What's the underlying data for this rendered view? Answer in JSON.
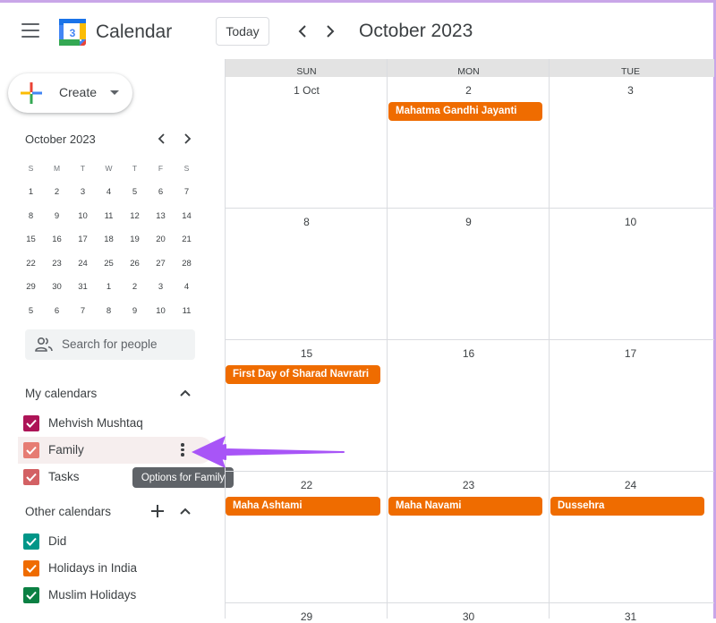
{
  "header": {
    "app_title": "Calendar",
    "logo_day": "3",
    "today_label": "Today",
    "month_title": "October 2023"
  },
  "sidebar": {
    "create_label": "Create",
    "mini_calendar": {
      "title": "October 2023",
      "weekdays": [
        "S",
        "M",
        "T",
        "W",
        "T",
        "F",
        "S"
      ],
      "weeks": [
        [
          "1",
          "2",
          "3",
          "4",
          "5",
          "6",
          "7"
        ],
        [
          "8",
          "9",
          "10",
          "11",
          "12",
          "13",
          "14"
        ],
        [
          "15",
          "16",
          "17",
          "18",
          "19",
          "20",
          "21"
        ],
        [
          "22",
          "23",
          "24",
          "25",
          "26",
          "27",
          "28"
        ],
        [
          "29",
          "30",
          "31",
          "1",
          "2",
          "3",
          "4"
        ],
        [
          "5",
          "6",
          "7",
          "8",
          "9",
          "10",
          "11"
        ]
      ]
    },
    "search_people_placeholder": "Search for people",
    "my_calendars": {
      "title": "My calendars",
      "items": [
        {
          "label": "Mehvish Mushtaq",
          "color": "#ad1457"
        },
        {
          "label": "Family",
          "color": "#e67c73"
        },
        {
          "label": "Tasks",
          "color": "#d36164"
        }
      ]
    },
    "tooltip": "Options for Family",
    "other_calendars": {
      "title": "Other calendars",
      "items": [
        {
          "label": "Did",
          "color": "#009688"
        },
        {
          "label": "Holidays in India",
          "color": "#ef6c00"
        },
        {
          "label": "Muslim Holidays",
          "color": "#0b8043"
        }
      ]
    }
  },
  "grid": {
    "day_headers": [
      "SUN",
      "MON",
      "TUE"
    ],
    "weeks": [
      {
        "days": [
          "1 Oct",
          "2",
          "3"
        ]
      },
      {
        "days": [
          "8",
          "9",
          "10"
        ]
      },
      {
        "days": [
          "15",
          "16",
          "17"
        ]
      },
      {
        "days": [
          "22",
          "23",
          "24"
        ]
      },
      {
        "days": [
          "29",
          "30",
          "31"
        ]
      }
    ],
    "events": [
      {
        "label": "Mahatma Gandhi Jayanti",
        "color": "#ef6c00"
      },
      {
        "label": "First Day of Sharad Navratri",
        "color": "#ef6c00"
      },
      {
        "label": "Maha Ashtami",
        "color": "#ef6c00"
      },
      {
        "label": "Maha Navami",
        "color": "#ef6c00"
      },
      {
        "label": "Dussehra",
        "color": "#ef6c00"
      }
    ]
  },
  "annotation": {
    "arrow_color": "#a855f7"
  }
}
